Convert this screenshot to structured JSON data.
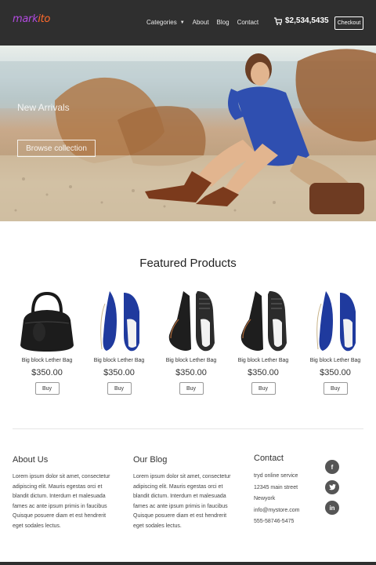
{
  "header": {
    "logo_part1": "mark",
    "logo_part2": "ito",
    "nav": [
      "Categories",
      "About",
      "Blog",
      "Contact"
    ],
    "cart_total": "$2,534,5435",
    "checkout_label": "Checkout"
  },
  "hero": {
    "title": "New Arrivals",
    "button": "Browse collection"
  },
  "featured": {
    "title": "Featured Products",
    "products": [
      {
        "name": "Big block Lether Bag",
        "price": "$350.00",
        "buy": "Buy",
        "icon": "bag-icon"
      },
      {
        "name": "Big block Lether Bag",
        "price": "$350.00",
        "buy": "Buy",
        "icon": "blue-shoes-icon"
      },
      {
        "name": "Big block Lether Bag",
        "price": "$350.00",
        "buy": "Buy",
        "icon": "black-sneakers-icon"
      },
      {
        "name": "Big block Lether Bag",
        "price": "$350.00",
        "buy": "Buy",
        "icon": "black-sneakers-icon"
      },
      {
        "name": "Big block Lether Bag",
        "price": "$350.00",
        "buy": "Buy",
        "icon": "blue-shoes-icon"
      }
    ]
  },
  "footer": {
    "about": {
      "title": "About Us",
      "lines": [
        "Lorem ipsum dolor sit amet, consectetur",
        "adipiscing elit. Mauris egestas orci et",
        "blandit dictum. Interdum et malesuada",
        "fames ac ante ipsum primis in faucibus",
        "Quisque posuere diam et est hendrerit",
        "eget sodales lectus."
      ]
    },
    "blog": {
      "title": "Our Blog",
      "lines": [
        "Lorem ipsum dolor sit amet, consectetur",
        "adipiscing elit. Mauris egestas orci et",
        "blandit dictum. Interdum et malesuada",
        "fames ac ante ipsum primis in faucibus",
        "Quisque posuere diam et est hendrerit",
        "eget sodales lectus."
      ]
    },
    "contact": {
      "title": "Contact",
      "lines": [
        "tryd online service",
        "12345 main street",
        "Newyork",
        "info@mystore.com",
        "555-58746-5475"
      ]
    },
    "social": [
      "f",
      "t",
      "in"
    ]
  },
  "colors": {
    "header_bg": "#2f2f2f",
    "logo_accent1": "#b24be0",
    "logo_accent2": "#ff6a2b"
  }
}
